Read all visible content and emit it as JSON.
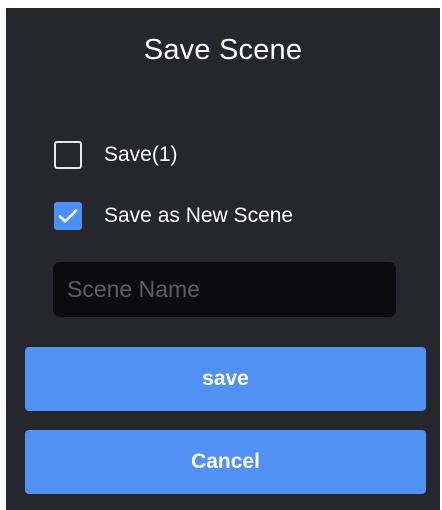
{
  "dialog": {
    "title": "Save Scene",
    "options": [
      {
        "label": "Save(1)",
        "checked": false,
        "checkbox_icon": "empty-checkbox-icon"
      },
      {
        "label": "Save as New Scene",
        "checked": true,
        "checkbox_icon": "checkmark-icon"
      }
    ],
    "scene_name": {
      "value": "",
      "placeholder": "Scene Name"
    },
    "save_label": "save",
    "cancel_label": "Cancel"
  },
  "colors": {
    "dialog_background": "#26262d",
    "accent": "#5191f4",
    "checkbox_checked": "#4a90f6",
    "input_background": "#0c0c0e",
    "placeholder": "#5d5d63",
    "text": "#ffffff"
  }
}
